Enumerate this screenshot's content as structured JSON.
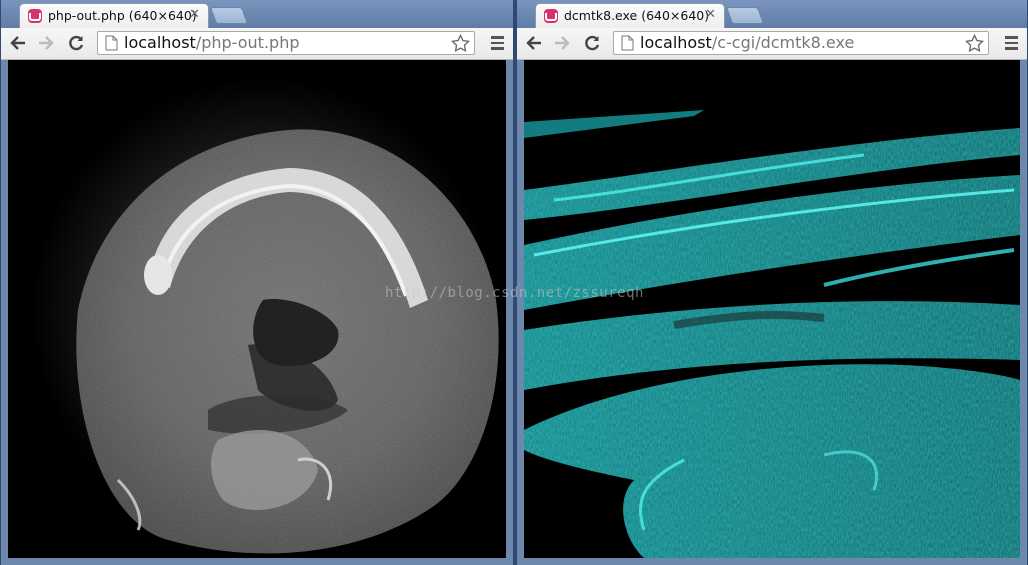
{
  "windows": [
    {
      "tab_title": "php-out.php (640×640)",
      "url_host": "localhost",
      "url_path": "/php-out.php",
      "image": "grayscale CT slice of jaw bone"
    },
    {
      "tab_title": "dcmtk8.exe (640×640)",
      "url_host": "localhost",
      "url_path": "/c-cgi/dcmtk8.exe",
      "image": "cyan-tinted stretched CT rendering"
    }
  ],
  "watermark": "http://blog.csdn.net/zssureqh",
  "icons": {
    "favicon": "page-favicon-icon",
    "close": "close-icon",
    "back": "back-arrow-icon",
    "forward": "forward-arrow-icon",
    "reload": "reload-icon",
    "page": "page-icon",
    "star": "bookmark-star-icon",
    "menu": "menu-icon"
  },
  "colors": {
    "cyan": "#1fc6c6",
    "window_frame": "#6d87ad",
    "tab_favicon": "#d6336c"
  }
}
